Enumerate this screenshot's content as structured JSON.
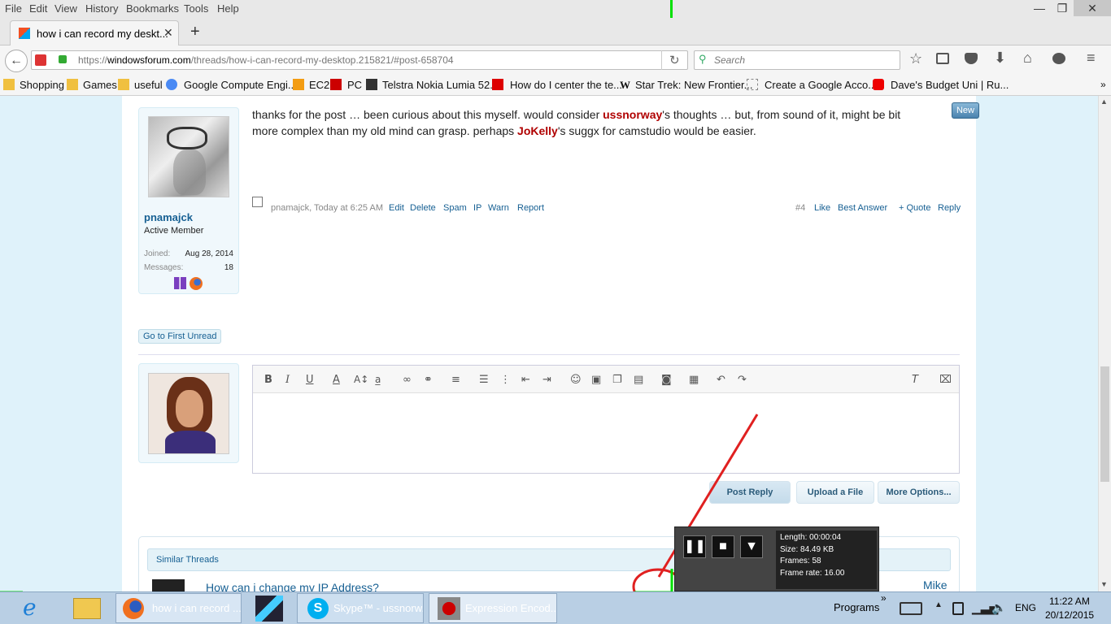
{
  "menu": [
    "File",
    "Edit",
    "View",
    "History",
    "Bookmarks",
    "Tools",
    "Help"
  ],
  "window_controls": {
    "minimize": "—",
    "maximize": "❐",
    "close": "✕"
  },
  "tab": {
    "title": "how i can record my deskt...",
    "close": "✕",
    "new_tab": "+"
  },
  "nav": {
    "url_prefix": "https://",
    "url_domain": "windowsforum.com",
    "url_path": "/threads/how-i-can-record-my-desktop.215821/#post-658704",
    "search_placeholder": "Search"
  },
  "bookmarks": [
    "Shopping",
    "Games",
    "useful",
    "Google Compute Engi...",
    "EC2",
    "PC",
    "Telstra Nokia Lumia 52...",
    "How do I center the te...",
    "Star Trek: New Frontier...",
    "Create a Google Acco...",
    "Dave's Budget Uni | Ru..."
  ],
  "post": {
    "text_1": "thanks for the post … been curious about this myself. would consider ",
    "mention_1": "ussnorway",
    "text_2": "'s thoughts … but, from sound of it, might be bit",
    "text_3": "more complex than my old mind can grasp. perhaps ",
    "mention_2": "JoKelly",
    "text_4": "'s suggx for camstudio would be easier.",
    "new_badge": "New",
    "meta": "pnamajck, Today at 6:25 AM",
    "actions": [
      "Edit",
      "Delete",
      "Spam",
      "IP",
      "Warn",
      "Report"
    ],
    "number": "#4",
    "right_actions": [
      "Like",
      "Best Answer",
      "+ Quote",
      "Reply"
    ]
  },
  "user": {
    "name": "pnamajck",
    "title": "Active Member",
    "joined_label": "Joined:",
    "joined_value": "Aug 28, 2014",
    "messages_label": "Messages:",
    "messages_value": "18"
  },
  "go_first_unread": "Go to First Unread",
  "reply_buttons": {
    "post_reply": "Post Reply",
    "upload": "Upload a File",
    "more": "More Options..."
  },
  "similar": {
    "header": "Similar Threads",
    "first_title": "How can i change my IP Address?",
    "first_user": "Mike"
  },
  "recorder": {
    "length": "Length: 00:00:04",
    "size": "Size: 84.49 KB",
    "frames": "Frames: 58",
    "frame_rate": "Frame rate: 16.00"
  },
  "taskbar": {
    "firefox": "how i can record ...",
    "skype": "Skype™ - ussnorw...",
    "encoder": "Expression Encod...",
    "programs": "Programs",
    "lang": "ENG",
    "time": "11:22 AM",
    "date": "20/12/2015",
    "chevron": "»"
  },
  "colors": {
    "mention": "#b00000",
    "link": "#176093",
    "page_bg": "#dff2fa",
    "annotation": "#e02020",
    "recording_border": "#00e000"
  }
}
